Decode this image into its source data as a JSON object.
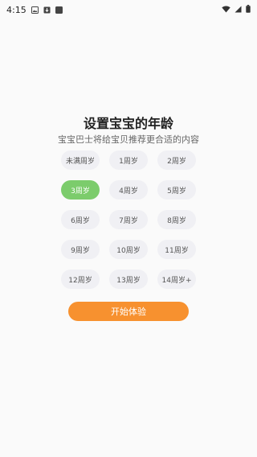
{
  "status_bar": {
    "time": "4:15",
    "notification_icons": [
      "gallery-icon",
      "download-icon",
      "app-icon"
    ],
    "right_icons": [
      "wifi-icon",
      "signal-icon",
      "battery-icon"
    ]
  },
  "title": "设置宝宝的年龄",
  "subtitle": "宝宝巴士将给宝贝推荐更合适的内容",
  "age_options": [
    {
      "label": "未满周岁",
      "selected": false
    },
    {
      "label": "1周岁",
      "selected": false
    },
    {
      "label": "2周岁",
      "selected": false
    },
    {
      "label": "3周岁",
      "selected": true
    },
    {
      "label": "4周岁",
      "selected": false
    },
    {
      "label": "5周岁",
      "selected": false
    },
    {
      "label": "6周岁",
      "selected": false
    },
    {
      "label": "7周岁",
      "selected": false
    },
    {
      "label": "8周岁",
      "selected": false
    },
    {
      "label": "9周岁",
      "selected": false
    },
    {
      "label": "10周岁",
      "selected": false
    },
    {
      "label": "11周岁",
      "selected": false
    },
    {
      "label": "12周岁",
      "selected": false
    },
    {
      "label": "13周岁",
      "selected": false
    },
    {
      "label": "14周岁+",
      "selected": false
    }
  ],
  "start_button": "开始体验",
  "colors": {
    "selected": "#7ccc6c",
    "option_bg": "#f0f0f4",
    "accent": "#f7912f"
  }
}
